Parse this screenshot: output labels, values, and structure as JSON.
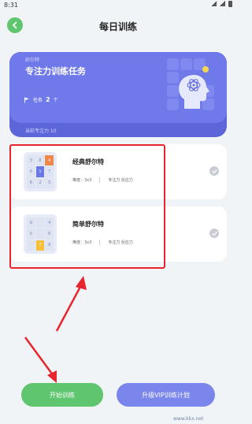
{
  "status": {
    "time": "8:31"
  },
  "header": {
    "title": "每日训练"
  },
  "task_card": {
    "badge": "舒尔特",
    "title": "专注力训练任务",
    "count_label": "任务",
    "count_value": "2",
    "count_unit": "个",
    "footer": "当前专注力 10"
  },
  "games": [
    {
      "name": "经典舒尔特",
      "difficulty": "难度：3x3",
      "tags": "专注力 反应力",
      "grid": [
        "3",
        "8",
        "4",
        "9",
        "1",
        "7",
        "6",
        "2",
        "5"
      ]
    },
    {
      "name": "简单舒尔特",
      "difficulty": "难度：3x3",
      "tags": "专注力 反应力",
      "grid": [
        "9",
        "",
        "4",
        "5",
        "",
        "6",
        "",
        "7",
        "8"
      ]
    }
  ],
  "buttons": {
    "start": "开始训练",
    "vip": "升级VIP训练计划"
  },
  "watermark": "www.kkx.net"
}
